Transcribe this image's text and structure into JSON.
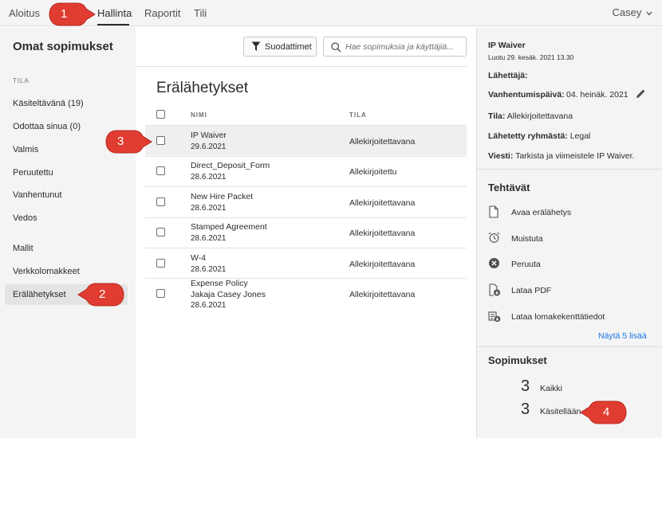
{
  "nav": {
    "tabs": [
      "Aloitus",
      "Hallinta",
      "Raportit",
      "Tili"
    ],
    "active_tab": "Hallinta",
    "user": "Casey"
  },
  "page_title": "Omat sopimukset",
  "toolbar": {
    "filter_label": "Suodattimet",
    "search_placeholder": "Hae sopimuksia ja käyttäjiä..."
  },
  "sidebar": {
    "section_label": "TILA",
    "status_items": [
      "Käsiteltävänä (19)",
      "Odottaa sinua (0)",
      "Valmis",
      "Peruutettu",
      "Vanhentunut",
      "Vedos"
    ],
    "other_items": [
      "Mallit",
      "Verkkolomakkeet",
      "Erälähetykset"
    ],
    "selected": "Erälähetykset"
  },
  "list": {
    "title": "Erälähetykset",
    "columns": [
      "NIMI",
      "TILA"
    ],
    "rows": [
      {
        "name": "IP Waiver",
        "sub": "",
        "date": "29.6.2021",
        "status": "Allekirjoitettavana"
      },
      {
        "name": "Direct_Deposit_Form",
        "sub": "",
        "date": "28.6.2021",
        "status": "Allekirjoitettu"
      },
      {
        "name": "New Hire Packet",
        "sub": "",
        "date": "28.6.2021",
        "status": "Allekirjoitettavana"
      },
      {
        "name": "Stamped Agreement",
        "sub": "",
        "date": "28.6.2021",
        "status": "Allekirjoitettavana"
      },
      {
        "name": "W-4",
        "sub": "",
        "date": "28.6.2021",
        "status": "Allekirjoitettavana"
      },
      {
        "name": "Expense Policy",
        "sub": "Jakaja Casey Jones",
        "date": "28.6.2021",
        "status": "Allekirjoitettavana"
      }
    ]
  },
  "details": {
    "title": "IP Waiver",
    "created": "Luotu 29. kesäk. 2021 13.30",
    "sender_label": "Lähettäjä:",
    "expiry_label": "Vanhentumispäivä:",
    "expiry_value": "04. heinäk. 2021",
    "status_label": "Tila:",
    "status_value": "Allekirjoitettavana",
    "group_label": "Lähetetty ryhmästä:",
    "group_value": "Legal",
    "message_label": "Viesti:",
    "message_value": "Tarkista ja viimeistele IP Waiver."
  },
  "tasks": {
    "heading": "Tehtävät",
    "items": [
      {
        "label": "Avaa erälähetys",
        "icon": "document-icon"
      },
      {
        "label": "Muistuta",
        "icon": "alarm-clock-icon"
      },
      {
        "label": "Peruuta",
        "icon": "cancel-icon"
      },
      {
        "label": "Lataa PDF",
        "icon": "download-pdf-icon"
      },
      {
        "label": "Lataa lomakekenttätiedot",
        "icon": "download-form-data-icon"
      }
    ],
    "more_link": "Näytä 5 lisää"
  },
  "agreements": {
    "heading": "Sopimukset",
    "items": [
      {
        "count": "3",
        "label": "Kaikki"
      },
      {
        "count": "3",
        "label": "Käsitellään"
      }
    ]
  },
  "callouts": [
    "1",
    "2",
    "3",
    "4"
  ],
  "colors": {
    "callout_red": "#e03c31",
    "link_blue": "#1473e6",
    "panel_gray": "#f4f4f4"
  }
}
